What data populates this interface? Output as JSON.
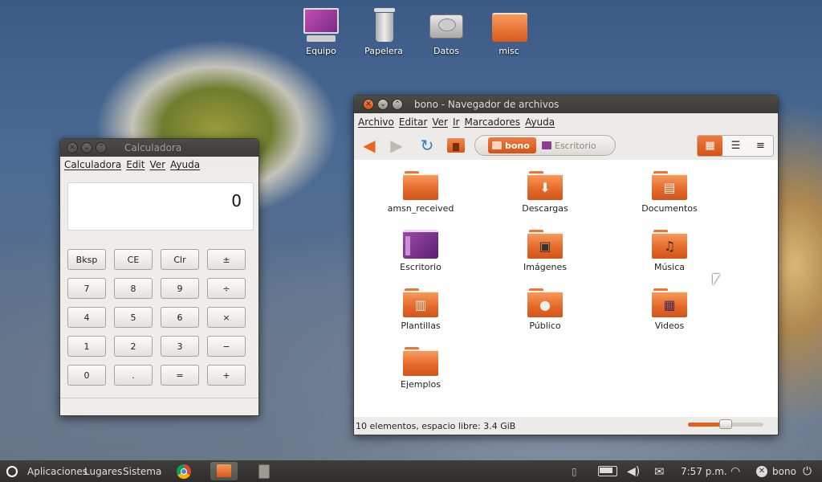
{
  "desktop": {
    "icons": [
      {
        "label": "Equipo",
        "icon": "computer-icon"
      },
      {
        "label": "Papelera",
        "icon": "trash-icon"
      },
      {
        "label": "Datos",
        "icon": "harddisk-icon"
      },
      {
        "label": "misc",
        "icon": "folder-icon"
      }
    ]
  },
  "calculator": {
    "title": "Calculadora",
    "menu": [
      "Calculadora",
      "Edit",
      "Ver",
      "Ayuda"
    ],
    "display": "0",
    "buttons": [
      "Bksp",
      "CE",
      "Clr",
      "±",
      "7",
      "8",
      "9",
      "÷",
      "4",
      "5",
      "6",
      "×",
      "1",
      "2",
      "3",
      "−",
      "0",
      ".",
      "=",
      "+"
    ]
  },
  "nautilus": {
    "title": "bono - Navegador de archivos",
    "menu": [
      "Archivo",
      "Editar",
      "Ver",
      "Ir",
      "Marcadores",
      "Ayuda"
    ],
    "breadcrumbs": [
      "bono",
      "Escritorio"
    ],
    "items": [
      {
        "label": "amsn_received",
        "emblem": ""
      },
      {
        "label": "Descargas",
        "emblem": "download-arrow-icon"
      },
      {
        "label": "Documentos",
        "emblem": "document-icon"
      },
      {
        "label": "Escritorio",
        "emblem": "desktop-icon"
      },
      {
        "label": "Imágenes",
        "emblem": "picture-icon"
      },
      {
        "label": "Música",
        "emblem": "music-note-icon"
      },
      {
        "label": "Plantillas",
        "emblem": "template-icon"
      },
      {
        "label": "Público",
        "emblem": "person-icon"
      },
      {
        "label": "Videos",
        "emblem": "film-icon"
      },
      {
        "label": "Ejemplos",
        "emblem": ""
      }
    ],
    "status": "10 elementos, espacio libre: 3.4 GiB",
    "zoom_level": 0.5
  },
  "panel": {
    "menus": [
      "Aplicaciones",
      "Lugares",
      "Sistema"
    ],
    "clock": "7:57 p.m.",
    "user": "bono"
  },
  "colors": {
    "accent": "#e05f1f",
    "panel": "#3c3b37",
    "folder": "#e46a2b"
  }
}
